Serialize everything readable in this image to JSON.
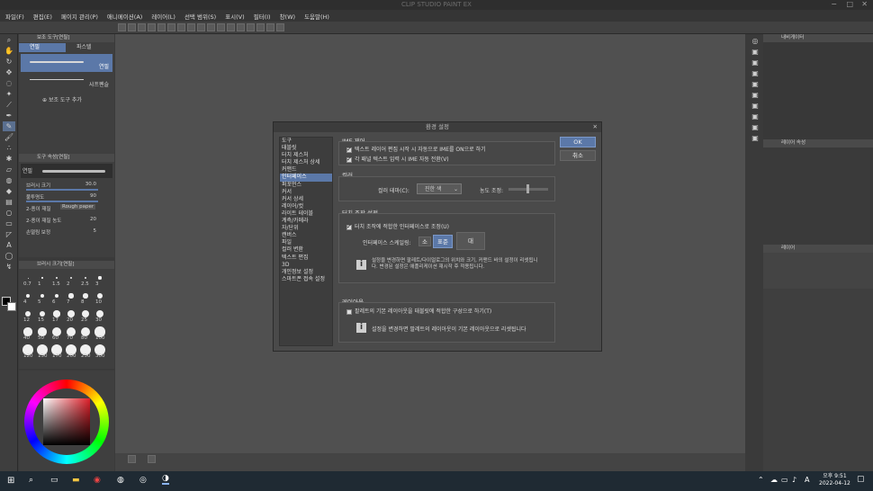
{
  "app": {
    "title": "CLIP STUDIO PAINT EX"
  },
  "menu": [
    "파일(F)",
    "편집(E)",
    "페이지 관리(P)",
    "애니메이션(A)",
    "레이어(L)",
    "선택 범위(S)",
    "표시(V)",
    "필터(I)",
    "창(W)",
    "도움말(H)"
  ],
  "subtool": {
    "title": "보조 도구[연필]",
    "tabs": [
      "연필",
      "파스텔"
    ],
    "items": [
      "연필",
      "샤프펜슬"
    ],
    "add": "보조 도구 추가"
  },
  "toolprop": {
    "title": "도구 속성[연필]",
    "preset": "연필",
    "rows": [
      {
        "label": "브러시 크기",
        "value": "30.0"
      },
      {
        "label": "불투명도",
        "value": "90"
      },
      {
        "label": "2-종이 재질",
        "value": "Rough paper"
      },
      {
        "label": "2-종이 재질 농도",
        "value": "20"
      },
      {
        "label": "손떨림 보정",
        "value": "5"
      }
    ]
  },
  "brushsize": {
    "title": "브러시 크기[연필]",
    "sizes": [
      "0.7",
      "1",
      "1.5",
      "2",
      "2.5",
      "3",
      "4",
      "5",
      "6",
      "7",
      "8",
      "10",
      "12",
      "15",
      "17",
      "20",
      "25",
      "30",
      "40",
      "50",
      "60",
      "70",
      "80",
      "100",
      "120",
      "150",
      "170",
      "200",
      "250",
      "300"
    ]
  },
  "rightpanel": {
    "navigator": "내비게이터",
    "layer_prop": "레이어 속성",
    "layer": "레이어"
  },
  "dialog": {
    "title": "환경 설정",
    "categories": [
      "도구",
      "태블릿",
      "터치 제스처",
      "터치 제스처 상세",
      "커맨드",
      "인터페이스",
      "퍼포먼스",
      "커서",
      "커서 상세",
      "레이어/컷",
      "라이트 테이블",
      "계측/카메라",
      "자/단위",
      "캔버스",
      "파일",
      "컬러 변환",
      "텍스트 편집",
      "3D",
      "개인정보 설정",
      "스마트폰 접속 설정"
    ],
    "selected_category": "인터페이스",
    "ime": {
      "title": "IME 제어",
      "opt1": "텍스트 레이어 편집 시작 시 자동으로 IME를 ON으로 하기",
      "opt2": "각 패널 텍스트 입력 시 IME 자동 전환(V)"
    },
    "color": {
      "title": "컬러",
      "theme_label": "컬러 테마(C):",
      "theme_value": "진한 색",
      "density_label": "농도 조정:"
    },
    "touch": {
      "title": "터치 조작 설정",
      "opt": "터치 조작에 적합한 인터페이스로 조정(U)",
      "scale_label": "인터페이스 스케일링:",
      "scales": [
        "소",
        "표준",
        "대"
      ],
      "info": "설정을 변경하면 팔레트/다이얼로그의 위치와 크기, 커맨드 바의 설정이 리셋됩니다. 변경된 설정은 애플리케이션 재시작 후 적용됩니다."
    },
    "layout": {
      "title": "레이아웃",
      "opt": "팔레트의 기본 레이아웃을 태블릿에 적합한 구성으로 하기(T)",
      "info": "설정을 변경하면 팔레트의 레이아웃이 기본 레이아웃으로 리셋됩니다"
    },
    "ok": "OK",
    "cancel": "취소"
  },
  "taskbar": {
    "time": "오후 9:51",
    "date": "2022-04-12",
    "ime": "A"
  }
}
